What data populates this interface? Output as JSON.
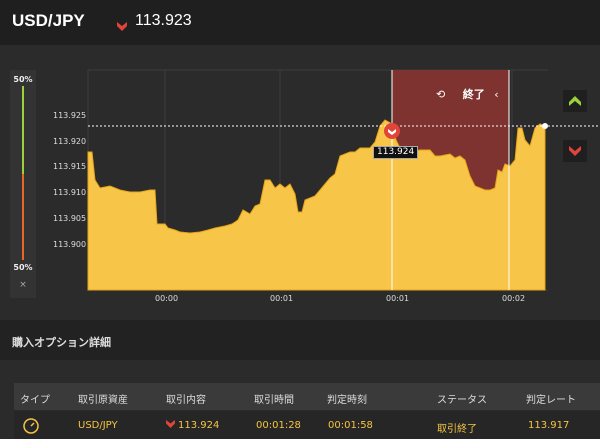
{
  "header": {
    "pair": "USD/JPY",
    "rate": "113.923",
    "direction": "down"
  },
  "gauge": {
    "top_label": "50%",
    "bottom_label": "50%",
    "close_label": "×"
  },
  "chart": {
    "y_ticks": [
      "113.925",
      "113.920",
      "113.915",
      "113.910",
      "113.905",
      "113.900"
    ],
    "x_ticks": [
      "00:00",
      "00:01",
      "00:01",
      "00:02"
    ],
    "marker_rate": "113.924",
    "end_label": "終了",
    "colors": {
      "fill": "#f7c648",
      "line": "#e8a317",
      "expired": "#7e3330",
      "bg": "#2b2b2b"
    }
  },
  "chart_data": {
    "type": "area",
    "x_ticks": [
      "00:00",
      "00:01",
      "00:01",
      "00:02"
    ],
    "ylim": [
      113.896,
      113.929
    ],
    "y_ticks": [
      113.925,
      113.92,
      113.915,
      113.91,
      113.905,
      113.9
    ],
    "current_rate": 113.923,
    "entry_rate": 113.924
  },
  "section": {
    "title": "購入オプション詳細"
  },
  "table": {
    "headers": [
      "タイプ",
      "取引原資産",
      "取引内容",
      "取引時間",
      "判定時刻",
      "ステータス",
      "判定レート"
    ],
    "row": {
      "asset": "USD/JPY",
      "content": "113.924",
      "time": "00:01:28",
      "judge_time": "00:01:58",
      "status": "取引終了",
      "judge_rate": "113.917"
    }
  }
}
